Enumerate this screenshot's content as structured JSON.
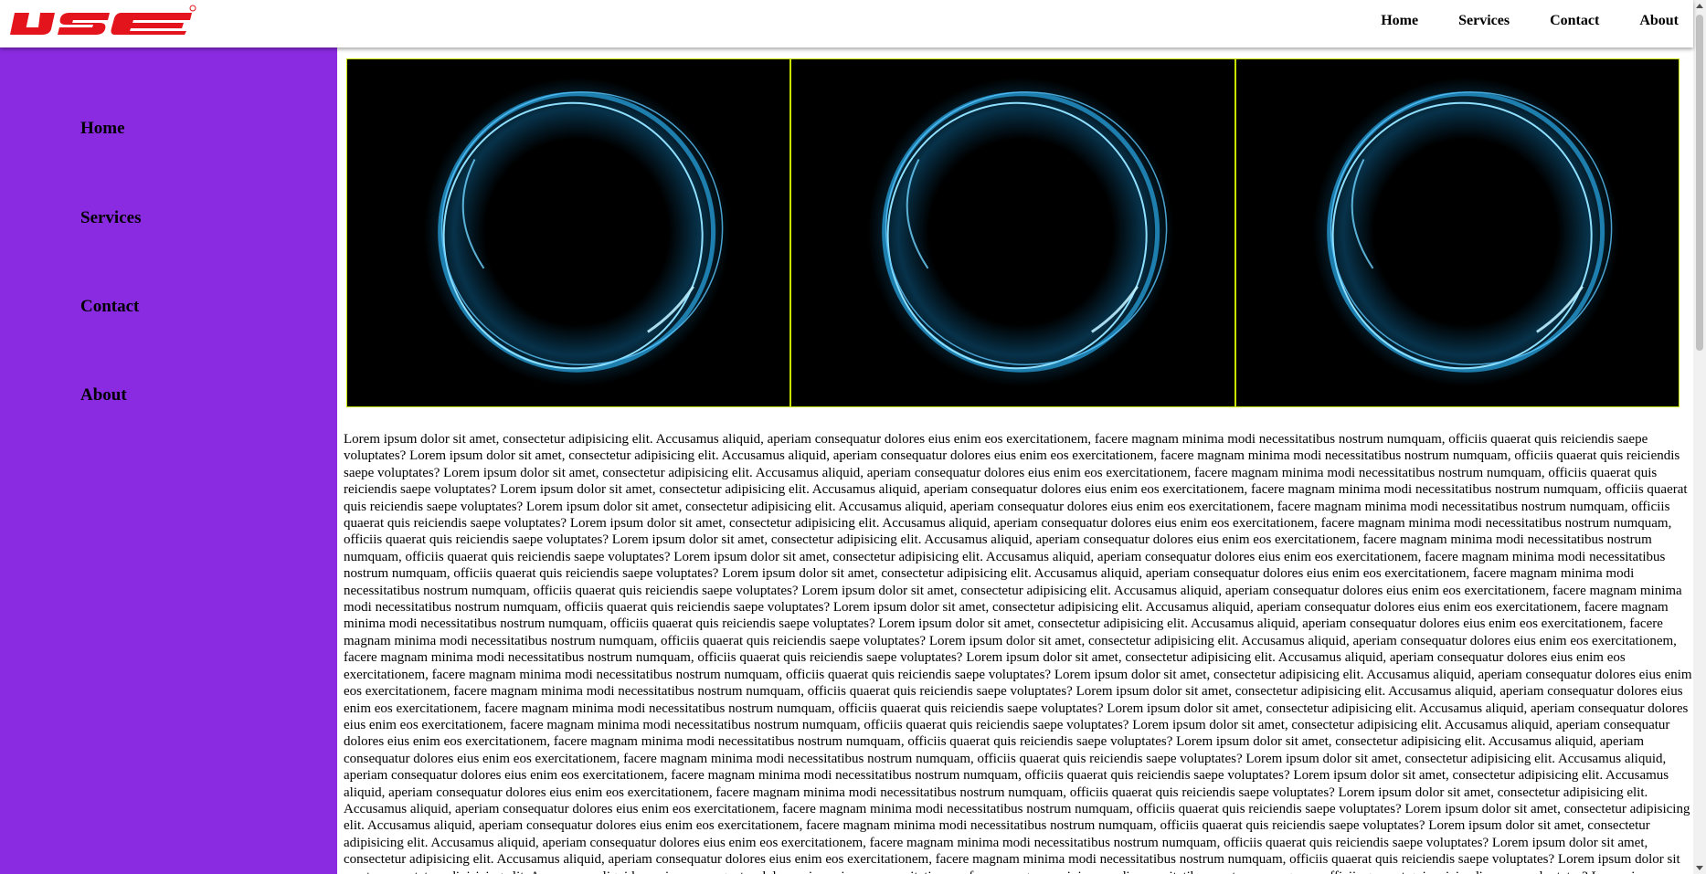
{
  "brand": {
    "logo_text": "IJSE",
    "logo_color": "#e3141b"
  },
  "header": {
    "nav": [
      "Home",
      "Services",
      "Contact",
      "About"
    ]
  },
  "sidebar": {
    "background": "#8a2be2",
    "items": [
      "Home",
      "Services",
      "Contact",
      "About"
    ]
  },
  "banner": {
    "panels": [
      {
        "image": "glowing-blue-ring"
      },
      {
        "image": "glowing-blue-ring"
      },
      {
        "image": "glowing-blue-ring"
      }
    ],
    "border_color": "#c8e600"
  },
  "content": {
    "paragraph": "Lorem ipsum dolor sit amet, consectetur adipisicing elit. Accusamus aliquid, aperiam consequatur dolores eius enim eos exercitationem, facere magnam minima modi necessitatibus nostrum numquam, officiis quaerat quis reiciendis saepe voluptates? Lorem ipsum dolor sit amet, consectetur adipisicing elit. Accusamus aliquid, aperiam consequatur dolores eius enim eos exercitationem, facere magnam minima modi necessitatibus nostrum numquam, officiis quaerat quis reiciendis saepe voluptates? Lorem ipsum dolor sit amet, consectetur adipisicing elit. Accusamus aliquid, aperiam consequatur dolores eius enim eos exercitationem, facere magnam minima modi necessitatibus nostrum numquam, officiis quaerat quis reiciendis saepe voluptates? Lorem ipsum dolor sit amet, consectetur adipisicing elit. Accusamus aliquid, aperiam consequatur dolores eius enim eos exercitationem, facere magnam minima modi necessitatibus nostrum numquam, officiis quaerat quis reiciendis saepe voluptates? Lorem ipsum dolor sit amet, consectetur adipisicing elit. Accusamus aliquid, aperiam consequatur dolores eius enim eos exercitationem, facere magnam minima modi necessitatibus nostrum numquam, officiis quaerat quis reiciendis saepe voluptates? Lorem ipsum dolor sit amet, consectetur adipisicing elit. Accusamus aliquid, aperiam consequatur dolores eius enim eos exercitationem, facere magnam minima modi necessitatibus nostrum numquam, officiis quaerat quis reiciendis saepe voluptates? Lorem ipsum dolor sit amet, consectetur adipisicing elit. Accusamus aliquid, aperiam consequatur dolores eius enim eos exercitationem, facere magnam minima modi necessitatibus nostrum numquam, officiis quaerat quis reiciendis saepe voluptates? Lorem ipsum dolor sit amet, consectetur adipisicing elit. Accusamus aliquid, aperiam consequatur dolores eius enim eos exercitationem, facere magnam minima modi necessitatibus nostrum numquam, officiis quaerat quis reiciendis saepe voluptates? Lorem ipsum dolor sit amet, consectetur adipisicing elit. Accusamus aliquid, aperiam consequatur dolores eius enim eos exercitationem, facere magnam minima modi necessitatibus nostrum numquam, officiis quaerat quis reiciendis saepe voluptates? Lorem ipsum dolor sit amet, consectetur adipisicing elit. Accusamus aliquid, aperiam consequatur dolores eius enim eos exercitationem, facere magnam minima modi necessitatibus nostrum numquam, officiis quaerat quis reiciendis saepe voluptates? Lorem ipsum dolor sit amet, consectetur adipisicing elit. Accusamus aliquid, aperiam consequatur dolores eius enim eos exercitationem, facere magnam minima modi necessitatibus nostrum numquam, officiis quaerat quis reiciendis saepe voluptates? Lorem ipsum dolor sit amet, consectetur adipisicing elit. Accusamus aliquid, aperiam consequatur dolores eius enim eos exercitationem, facere magnam minima modi necessitatibus nostrum numquam, officiis quaerat quis reiciendis saepe voluptates? Lorem ipsum dolor sit amet, consectetur adipisicing elit. Accusamus aliquid, aperiam consequatur dolores eius enim eos exercitationem, facere magnam minima modi necessitatibus nostrum numquam, officiis quaerat quis reiciendis saepe voluptates? Lorem ipsum dolor sit amet, consectetur adipisicing elit. Accusamus aliquid, aperiam consequatur dolores eius enim eos exercitationem, facere magnam minima modi necessitatibus nostrum numquam, officiis quaerat quis reiciendis saepe voluptates? Lorem ipsum dolor sit amet, consectetur adipisicing elit. Accusamus aliquid, aperiam consequatur dolores eius enim eos exercitationem, facere magnam minima modi necessitatibus nostrum numquam, officiis quaerat quis reiciendis saepe voluptates? Lorem ipsum dolor sit amet, consectetur adipisicing elit. Accusamus aliquid, aperiam consequatur dolores eius enim eos exercitationem, facere magnam minima modi necessitatibus nostrum numquam, officiis quaerat quis reiciendis saepe voluptates? Lorem ipsum dolor sit amet, consectetur adipisicing elit. Accusamus aliquid, aperiam consequatur dolores eius enim eos exercitationem, facere magnam minima modi necessitatibus nostrum numquam, officiis quaerat quis reiciendis saepe voluptates? Lorem ipsum dolor sit amet, consectetur adipisicing elit. Accusamus aliquid, aperiam consequatur dolores eius enim eos exercitationem, facere magnam minima modi necessitatibus nostrum numquam, officiis quaerat quis reiciendis saepe voluptates? Lorem ipsum dolor sit amet, consectetur adipisicing elit. Accusamus aliquid, aperiam consequatur dolores eius enim eos exercitationem, facere magnam minima modi necessitatibus nostrum numquam, officiis quaerat quis reiciendis saepe voluptates? Lorem ipsum dolor sit amet, consectetur adipisicing elit. Accusamus aliquid, aperiam consequatur dolores eius enim eos exercitationem, facere magnam minima modi necessitatibus nostrum numquam, officiis quaerat quis reiciendis saepe voluptates? Lorem ipsum dolor sit amet, consectetur adipisicing elit. Accusamus aliquid, aperiam consequatur dolores eius enim eos exercitationem, facere magnam minima modi necessitatibus nostrum numquam, officiis quaerat quis reiciendis saepe voluptates? Lorem ipsum dolor sit amet, consectetur adipisicing elit. Accusamus aliquid, aperiam consequatur dolores eius enim eos exercitationem, facere magnam minima modi necessitatibus nostrum numquam, officiis quaerat quis reiciendis saepe voluptates? Lorem ipsum dolor sit amet, consectetur adipisicing elit. Accusamus aliquid, aperiam consequatur dolores eius enim eos exercitationem, facere magnam minima modi necessitatibus nostrum numquam, officiis quaerat quis reiciendis saepe voluptates? Lorem ipsum dolor sit amet, consectetur adipisicing elit. Accusamus aliquid, aperiam consequatur dolores eius enim eos exercitationem, facere magnam minima modi necessitatibus nostrum numquam, officiis quaerat quis reiciendis saepe voluptates? Lorem ipsum dolor sit amet, consectetur adipisicing elit. Accusamus aliquid, aperiam consequatur dolores eius enim eos exercitationem, facere magnam minima modi necessitatibus nostrum numquam, officiis quaerat quis reiciendis saepe voluptates? Lorem ipsum dolor sit amet, consectetur adipisicing elit. Accusamus aliquid, aperiam consequatur dolores eius enim eos exercitationem, facere magnam minima modi necessitatibus nostrum numquam, officiis quaerat quis reiciendis saepe voluptates? Lorem ipsum dolor sit amet, consectetur adipisicing elit. Accusamus aliquid, aperiam consequatur dolores eius enim eos exercitationem, facere magnam minima modi necessitatibus nostrum numquam, officiis quaerat quis reiciendis saepe voluptates?"
  }
}
